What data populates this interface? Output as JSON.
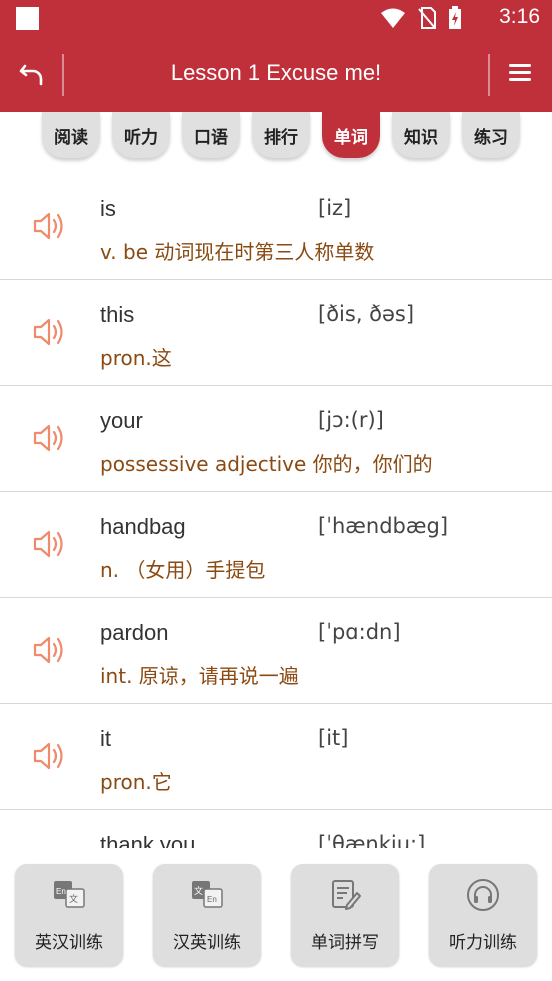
{
  "status_bar": {
    "time": "3:16"
  },
  "app_bar": {
    "title": "Lesson 1 Excuse me!"
  },
  "tabs": [
    {
      "label": "阅读",
      "active": false
    },
    {
      "label": "听力",
      "active": false
    },
    {
      "label": "口语",
      "active": false
    },
    {
      "label": "排行",
      "active": false
    },
    {
      "label": "单词",
      "active": true
    },
    {
      "label": "知识",
      "active": false
    },
    {
      "label": "练习",
      "active": false
    }
  ],
  "words": [
    {
      "word": "is",
      "phonetic": "[iz]",
      "meaning": "v. be 动词现在时第三人称单数"
    },
    {
      "word": "this",
      "phonetic": "[ðis, ðəs]",
      "meaning": "pron.这"
    },
    {
      "word": "your",
      "phonetic": "[jɔ:(r)]",
      "meaning": "possessive adjective 你的，你们的"
    },
    {
      "word": "handbag",
      "phonetic": "[ˈhændbæg]",
      "meaning": "n. （女用）手提包"
    },
    {
      "word": "pardon",
      "phonetic": "[ˈpɑ:dn]",
      "meaning": "int. 原谅，请再说一遍"
    },
    {
      "word": "it",
      "phonetic": "[it]",
      "meaning": "pron.它"
    },
    {
      "word": "thank you",
      "phonetic": "[ˈθæŋkju:]",
      "meaning": ""
    }
  ],
  "bottom_buttons": [
    {
      "label": "英汉训练",
      "icon": "en-zh-translate-icon"
    },
    {
      "label": "汉英训练",
      "icon": "zh-en-translate-icon"
    },
    {
      "label": "单词拼写",
      "icon": "spelling-pen-icon"
    },
    {
      "label": "听力训练",
      "icon": "headphones-icon"
    }
  ],
  "colors": {
    "primary": "#c0303b",
    "meaning_text": "#8a4a12",
    "speaker": "#f08a6a"
  }
}
